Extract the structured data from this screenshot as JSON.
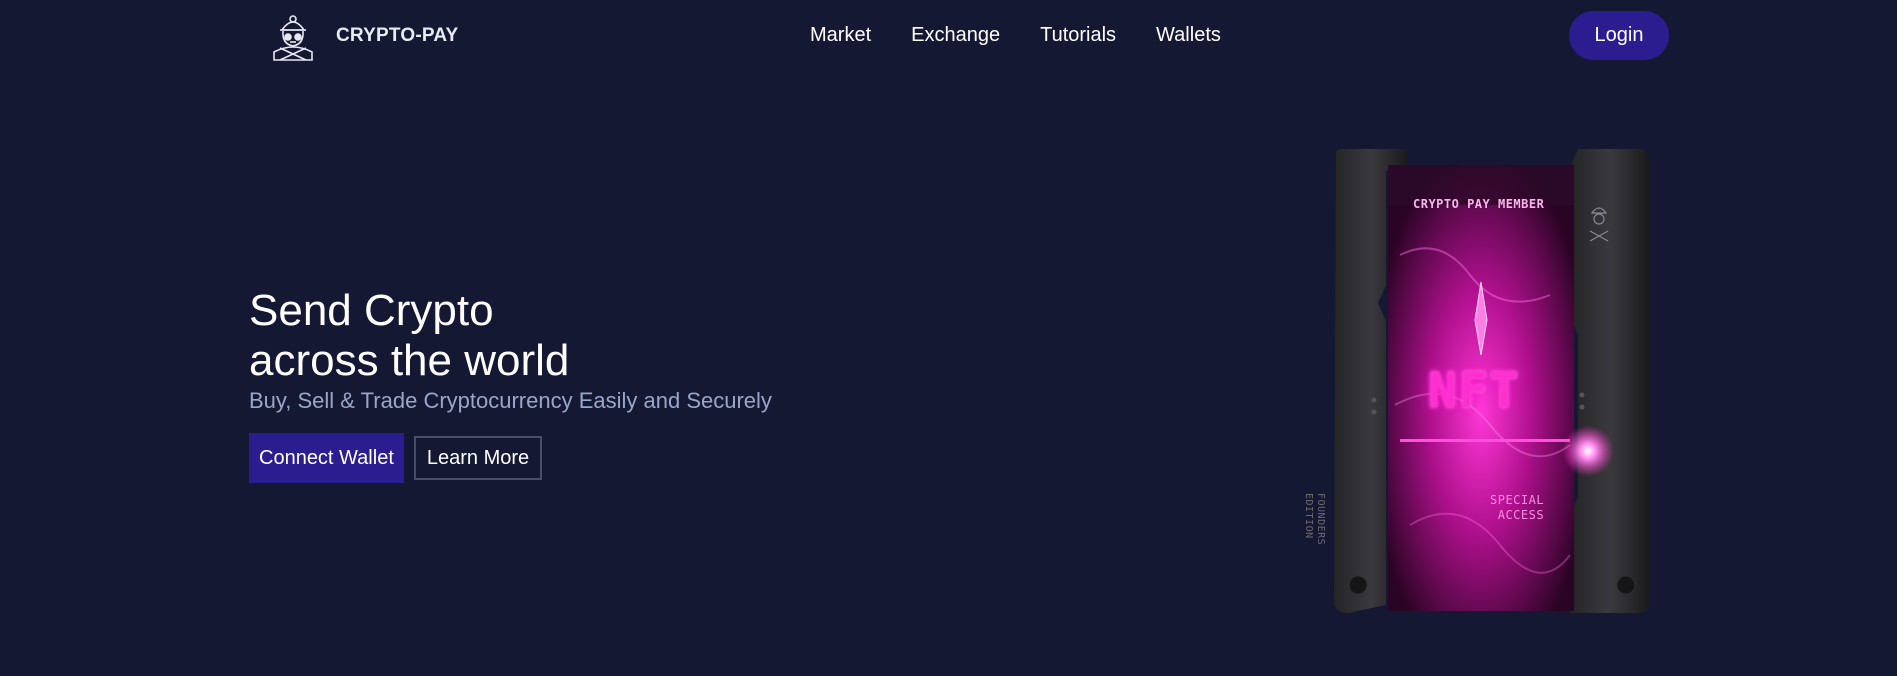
{
  "header": {
    "brand": "CRYPTO-PAY",
    "nav": [
      {
        "label": "Market"
      },
      {
        "label": "Exchange"
      },
      {
        "label": "Tutorials"
      },
      {
        "label": "Wallets"
      }
    ],
    "login_label": "Login"
  },
  "hero": {
    "title_line1": "Send Crypto",
    "title_line2": "across the world",
    "subtitle": "Buy, Sell & Trade Cryptocurrency Easily and Securely",
    "primary_cta": "Connect Wallet",
    "secondary_cta": "Learn More"
  },
  "card": {
    "member_text": "CRYPTO PAY MEMBER",
    "center_text": "NFT",
    "special_line1": "SPECIAL",
    "special_line2": "ACCESS",
    "edition_line1": "FOUNDERS",
    "edition_line2": "EDITION"
  },
  "colors": {
    "background": "#151833",
    "accent": "#2b1d8f",
    "subtitle": "#9aa6c7",
    "neon": "#ff2fd0"
  },
  "icons": {
    "logo": "astronaut-mascot-icon"
  }
}
